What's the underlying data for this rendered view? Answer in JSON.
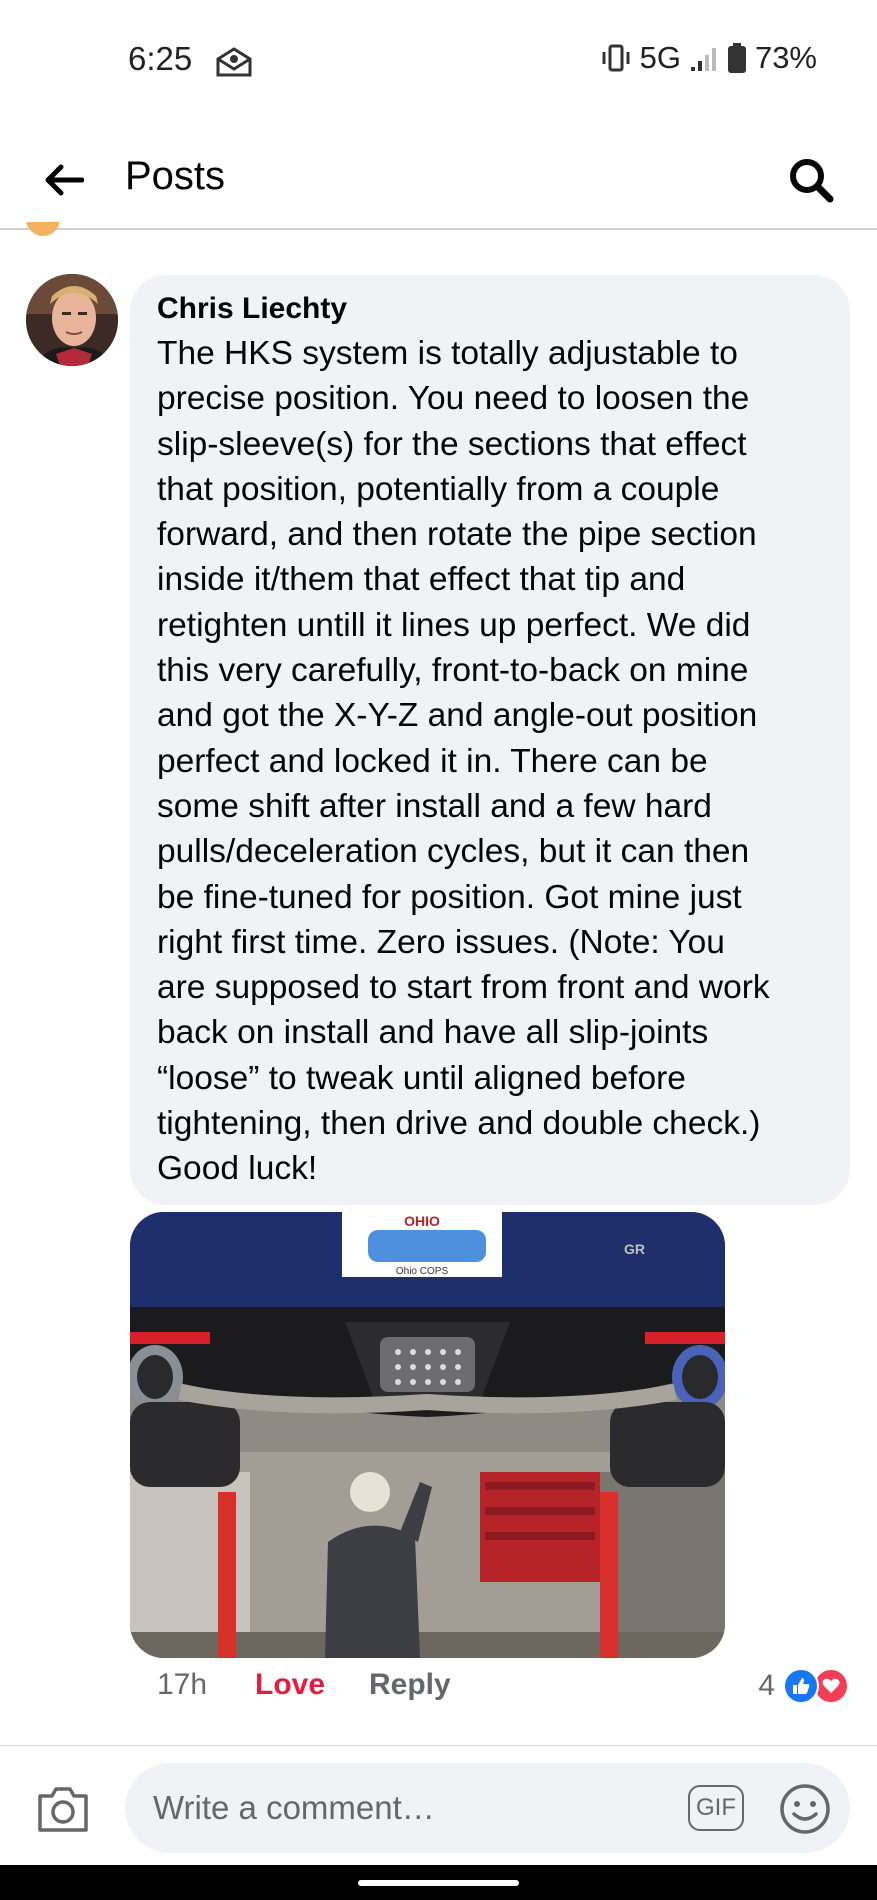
{
  "status_bar": {
    "time": "6:25",
    "network": "5G",
    "battery": "73%"
  },
  "header": {
    "title": "Posts"
  },
  "comment": {
    "author": "Chris Liechty",
    "text": "The HKS system is totally adjustable to\nprecise position.  You need to loosen the\nslip-sleeve(s) for the sections that effect\nthat position, potentially from a couple\nforward, and then rotate the pipe section\ninside it/them that effect that tip and\nretighten untill it lines up perfect.  We did\nthis very carefully, front-to-back on mine\nand got the X-Y-Z and angle-out position\nperfect and locked it in.  There can be\nsome shift after install and a few hard\npulls/deceleration cycles, but it can then\nbe fine-tuned for position.  Got mine just\nright first time.  Zero issues.  (Note:  You\nare supposed to start from front and work\nback on install and have all slip-joints\n“loose” to tweak until aligned before\ntightening, then drive and double check.)\nGood luck!",
    "time": "17h",
    "love_label": "Love",
    "reply_label": "Reply",
    "reaction_count": "4",
    "photo": {
      "plate_state": "OHIO",
      "plate_caption": "Ohio COPS",
      "badge": "GR"
    }
  },
  "composer": {
    "placeholder": "Write a comment…",
    "gif_label": "GIF"
  },
  "colors": {
    "bubble": "#f0f2f5",
    "love": "#e41e3f",
    "like": "#1877f2",
    "secondary_text": "#65676b"
  }
}
